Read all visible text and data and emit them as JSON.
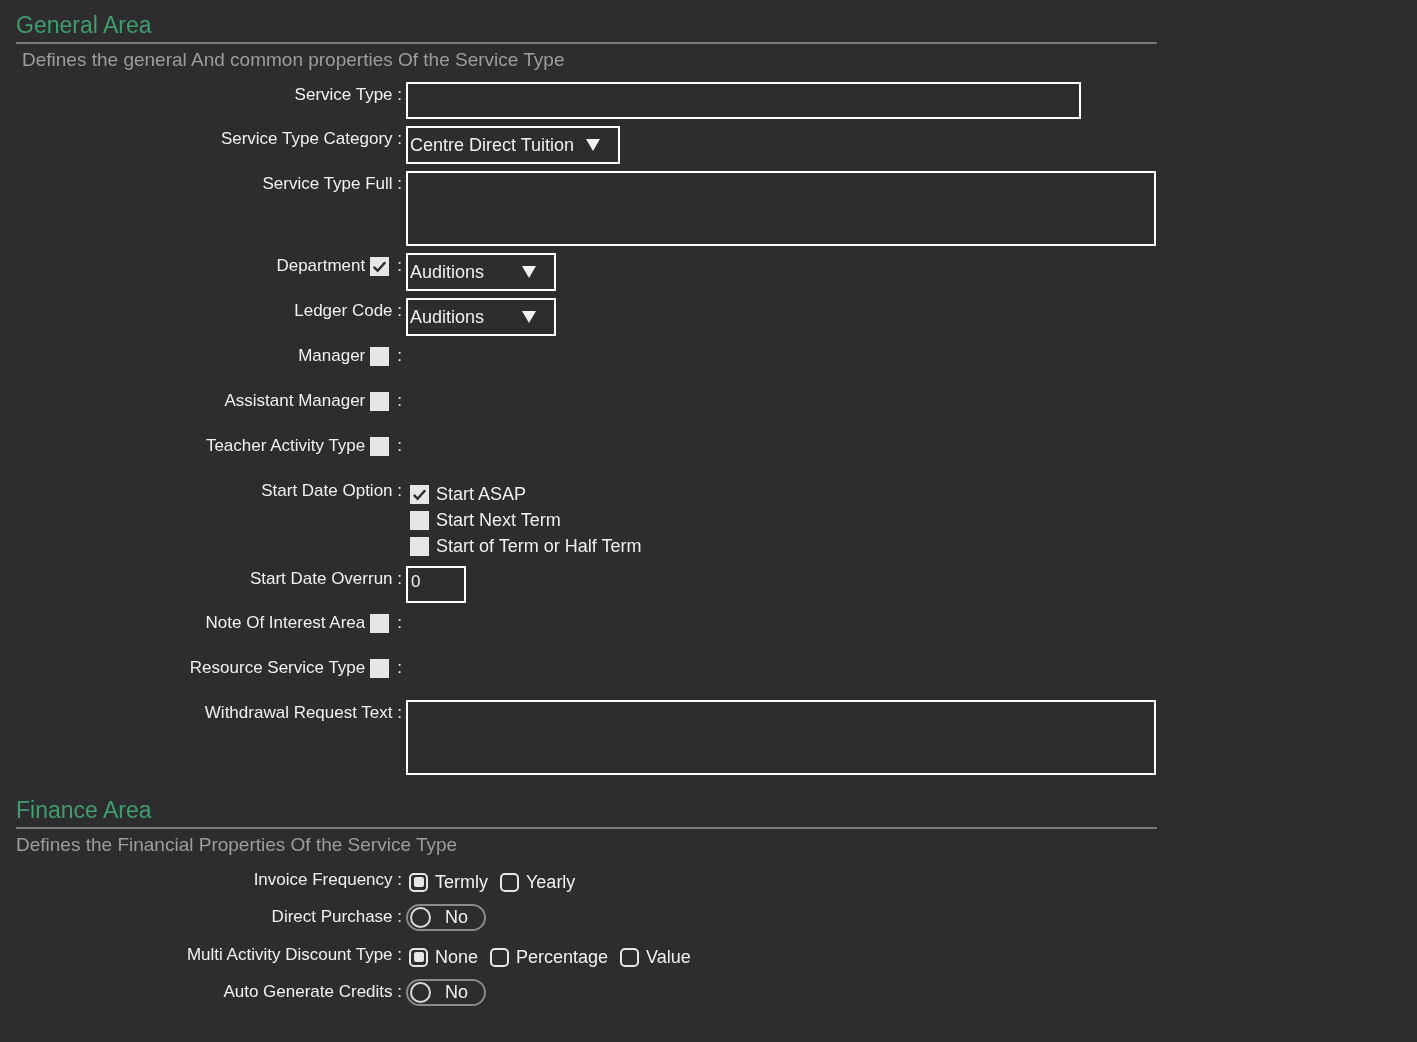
{
  "sections": [
    {
      "title": "General Area",
      "description": "Defines the general And common properties Of the Service Type",
      "fields": [
        {
          "kind": "text",
          "label": "Service Type :"
        },
        {
          "kind": "select",
          "label": "Service Type Category :",
          "value": "Centre Direct Tuition"
        },
        {
          "kind": "textarea",
          "label": "Service Type Full :"
        },
        {
          "kind": "select",
          "label": "Department",
          "checked": true,
          "colon": ":",
          "value": "Auditions"
        },
        {
          "kind": "select",
          "label": "Ledger Code :",
          "value": "Auditions"
        },
        {
          "kind": "none",
          "label": "Manager",
          "checked": false,
          "colon": ":"
        },
        {
          "kind": "none",
          "label": "Assistant Manager",
          "checked": false,
          "colon": ":"
        },
        {
          "kind": "none",
          "label": "Teacher Activity Type",
          "checked": false,
          "colon": ":"
        },
        {
          "kind": "checks",
          "label": "Start Date Option :",
          "options": [
            {
              "label": "Start ASAP",
              "checked": true
            },
            {
              "label": "Start Next Term",
              "checked": false
            },
            {
              "label": "Start of Term or Half Term",
              "checked": false
            }
          ]
        },
        {
          "kind": "number",
          "label": "Start Date Overrun :",
          "value": "0"
        },
        {
          "kind": "none",
          "label": "Note Of Interest Area",
          "checked": false,
          "colon": ":"
        },
        {
          "kind": "none",
          "label": "Resource Service Type",
          "checked": false,
          "colon": ":"
        },
        {
          "kind": "textarea",
          "label": "Withdrawal Request Text :"
        }
      ]
    },
    {
      "title": "Finance Area",
      "description": "Defines the Financial Properties Of the Service Type",
      "fields": [
        {
          "kind": "radios",
          "label": "Invoice Frequency :",
          "options": [
            {
              "label": "Termly",
              "selected": true
            },
            {
              "label": "Yearly",
              "selected": false
            }
          ]
        },
        {
          "kind": "toggle",
          "label": "Direct Purchase :",
          "on": false,
          "value": "No"
        },
        {
          "kind": "radios",
          "label": "Multi Activity Discount Type :",
          "options": [
            {
              "label": "None",
              "selected": true
            },
            {
              "label": "Percentage",
              "selected": false
            },
            {
              "label": "Value",
              "selected": false
            }
          ]
        },
        {
          "kind": "toggle",
          "label": "Auto Generate Credits :",
          "on": false,
          "value": "No"
        }
      ]
    }
  ]
}
